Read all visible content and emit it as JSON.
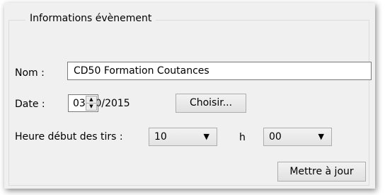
{
  "group": {
    "title": "Informations évènement"
  },
  "nom": {
    "label": "Nom :",
    "value": "CD50 Formation Coutances"
  },
  "date": {
    "label": "Date :",
    "value": "03/10/2015",
    "choose_label": "Choisir..."
  },
  "heure": {
    "label": "Heure début des tirs :",
    "hour_value": "10",
    "separator": "h",
    "minute_value": "00",
    "arrow_glyph": "▼"
  },
  "update_button": {
    "label": "Mettre à jour"
  },
  "icons": {
    "spin_up": "▲",
    "spin_down": "▼"
  }
}
